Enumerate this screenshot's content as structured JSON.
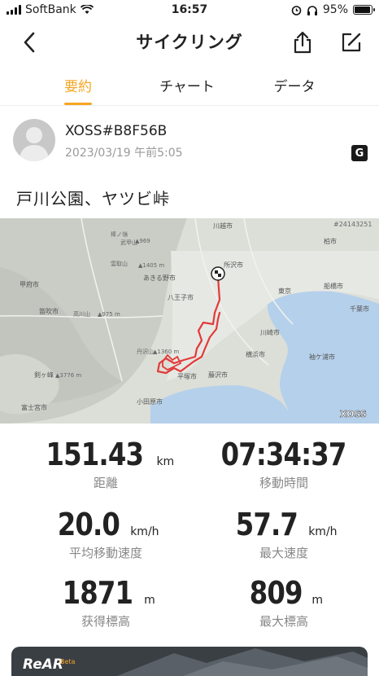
{
  "status": {
    "carrier": "SoftBank",
    "time": "16:57",
    "battery": "95%",
    "battery_level": 0.95
  },
  "nav": {
    "title": "サイクリング",
    "back_icon": "chevron-left-icon",
    "share_icon": "share-icon",
    "edit_icon": "edit-icon"
  },
  "tabs": [
    {
      "label": "要約",
      "active": true
    },
    {
      "label": "チャート",
      "active": false
    },
    {
      "label": "データ",
      "active": false
    }
  ],
  "profile": {
    "name": "XOSS#B8F56B",
    "datetime": "2023/03/19 午前5:05"
  },
  "route_title": "戸川公園、ヤツビ峠",
  "map": {
    "code": "#24143251",
    "watermark": "XOSS",
    "places": [
      "川越市",
      "柏市",
      "所沢市",
      "あきる野市",
      "東京",
      "船橋市",
      "八王子市",
      "千葉市",
      "甲府市",
      "笛吹市",
      "川崎市",
      "横浜市",
      "袖ケ浦市",
      "平塚市",
      "藤沢市",
      "剣ヶ峰",
      "富士宮市",
      "小田原市",
      "棒ノ嶺",
      "武甲山",
      "雲取山",
      "高川山",
      "丹沢山"
    ],
    "peaks": [
      "▲969",
      "▲1405 m",
      "▲975 m",
      "▲3776 m",
      "▲1360 m"
    ]
  },
  "stats": {
    "distance": {
      "value": "151.43",
      "unit": "km",
      "label": "距離"
    },
    "moving_time": {
      "value": "07:34:37",
      "unit": "",
      "label": "移動時間"
    },
    "avg_speed": {
      "value": "20.0",
      "unit": "km/h",
      "label": "平均移動速度"
    },
    "max_speed": {
      "value": "57.7",
      "unit": "km/h",
      "label": "最大速度"
    },
    "elevation_gain": {
      "value": "1871",
      "unit": "m",
      "label": "获得標高"
    },
    "max_elevation": {
      "value": "809",
      "unit": "m",
      "label": "最大標高"
    }
  },
  "banner": {
    "title": "ReAR",
    "badge": "Beta"
  },
  "colors": {
    "accent": "#f5a623",
    "route": "#e23a3a",
    "water": "#b5d0ea"
  }
}
